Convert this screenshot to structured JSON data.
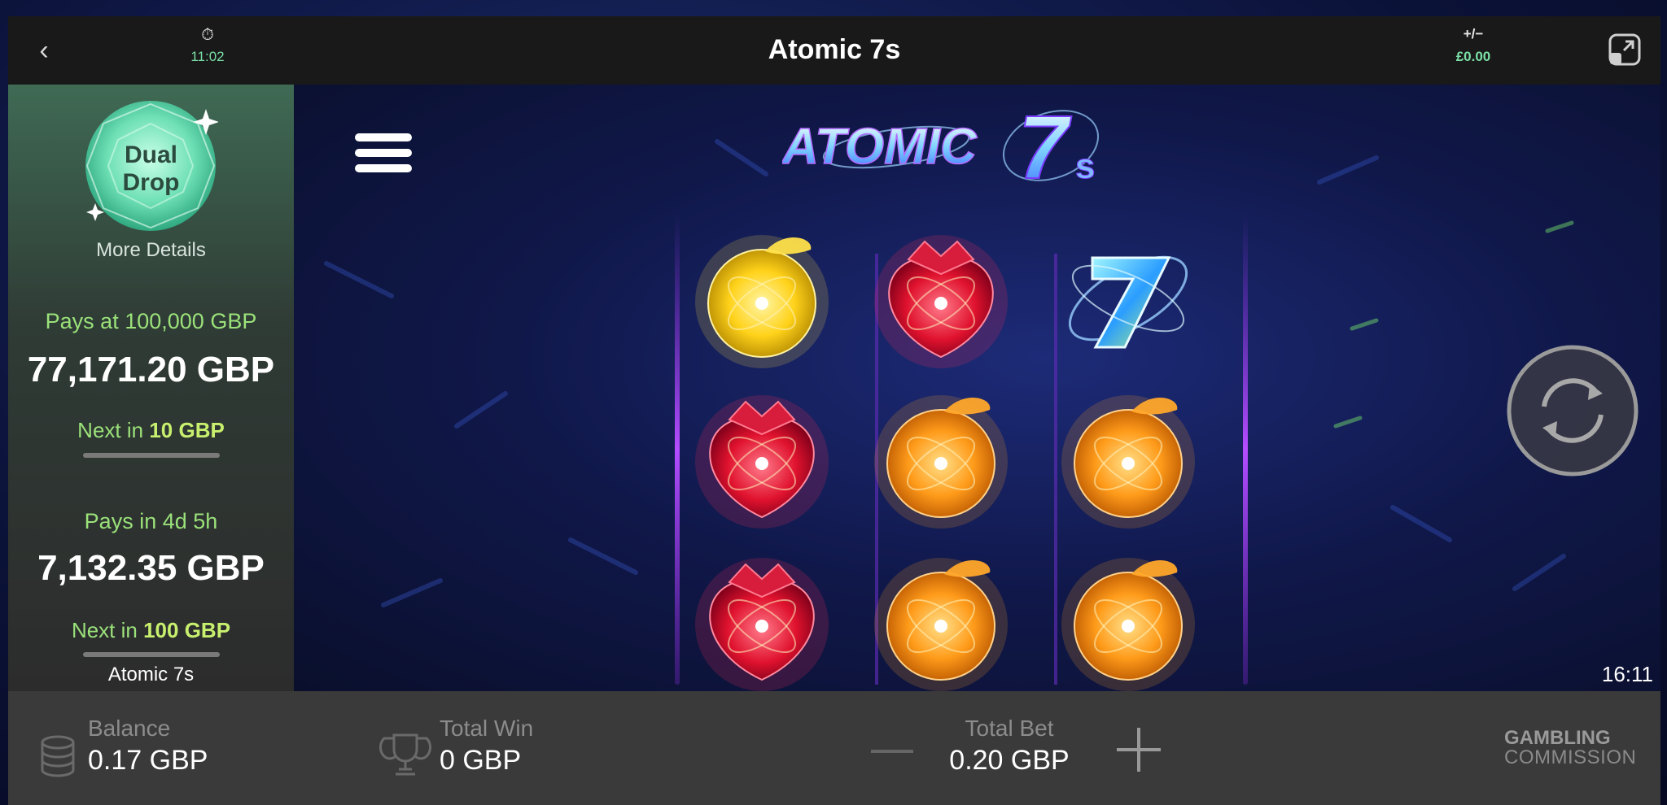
{
  "header": {
    "back_icon": "chevron-left-icon",
    "timer_icon": "stopwatch-icon",
    "session_time": "11:02",
    "title": "Atomic 7s",
    "profit_loss_label": "+/−",
    "profit_loss_value": "£0.00",
    "popout_icon": "popout-icon"
  },
  "jackpot_panel": {
    "badge_line1": "Dual",
    "badge_line2": "Drop",
    "more_details": "More Details",
    "jackpot1": {
      "pays_label": "Pays at",
      "pays_value": "100,000 GBP",
      "amount": "77,171.20 GBP",
      "next_label": "Next in",
      "next_value": "10 GBP"
    },
    "jackpot2": {
      "pays_label": "Pays in",
      "pays_value": "4d 5h",
      "amount": "7,132.35 GBP",
      "next_label": "Next in",
      "next_value": "100 GBP"
    },
    "game_name": "Atomic 7s"
  },
  "game": {
    "logo_text_main": "ATOMIC",
    "logo_text_seven": "7",
    "logo_text_s": "s",
    "reels": [
      [
        "lemon",
        "strawberry",
        "strawberry"
      ],
      [
        "strawberry",
        "orange",
        "orange"
      ],
      [
        "seven",
        "orange",
        "orange"
      ]
    ],
    "clock": "16:11",
    "spin_icon": "spin-refresh-icon",
    "menu_icon": "hamburger-menu-icon"
  },
  "footer": {
    "balance_label": "Balance",
    "balance_value": "0.17 GBP",
    "total_win_label": "Total Win",
    "total_win_value": "0 GBP",
    "total_bet_label": "Total Bet",
    "total_bet_value": "0.20 GBP",
    "regulator_line1": "GAMBLING",
    "regulator_line2": "COMMISSION"
  }
}
